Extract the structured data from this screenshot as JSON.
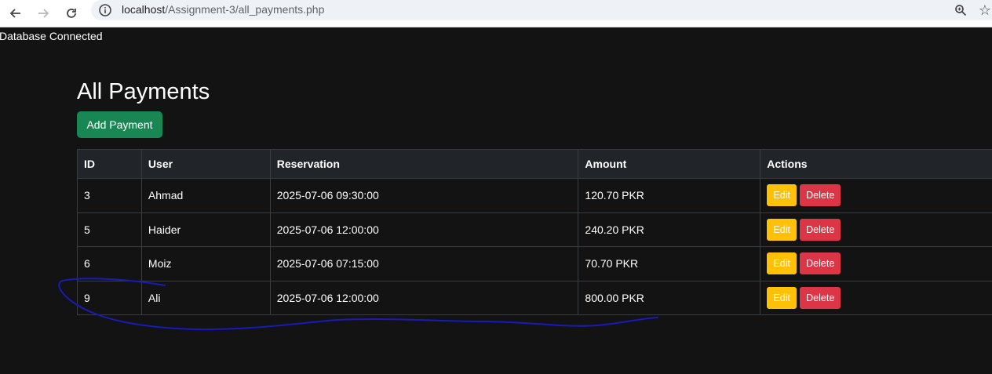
{
  "browser": {
    "url_host": "localhost",
    "url_path": "/Assignment-3/all_payments.php",
    "icons": [
      "back-arrow-icon",
      "forward-arrow-icon",
      "reload-icon",
      "site-info-icon",
      "zoom-icon",
      "bookmark-star-icon"
    ]
  },
  "page": {
    "db_status": "Database Connected",
    "title": "All Payments",
    "add_button": "Add Payment"
  },
  "table": {
    "headers": [
      "ID",
      "User",
      "Reservation",
      "Amount",
      "Actions"
    ],
    "rows": [
      {
        "id": "3",
        "user": "Ahmad",
        "reservation": "2025-07-06 09:30:00",
        "amount": "120.70 PKR",
        "edit": "Edit",
        "delete": "Delete"
      },
      {
        "id": "5",
        "user": "Haider",
        "reservation": "2025-07-06 12:00:00",
        "amount": "240.20 PKR",
        "edit": "Edit",
        "delete": "Delete"
      },
      {
        "id": "6",
        "user": "Moiz",
        "reservation": "2025-07-06 07:15:00",
        "amount": "70.70 PKR",
        "edit": "Edit",
        "delete": "Delete"
      },
      {
        "id": "9",
        "user": "Ali",
        "reservation": "2025-07-06 12:00:00",
        "amount": "800.00 PKR",
        "edit": "Edit",
        "delete": "Delete"
      }
    ]
  },
  "colors": {
    "background": "#131313",
    "header_bg": "#212529",
    "success": "#198754",
    "warning": "#ffc107",
    "danger": "#dc3545",
    "annotation": "#1a1ab8"
  }
}
